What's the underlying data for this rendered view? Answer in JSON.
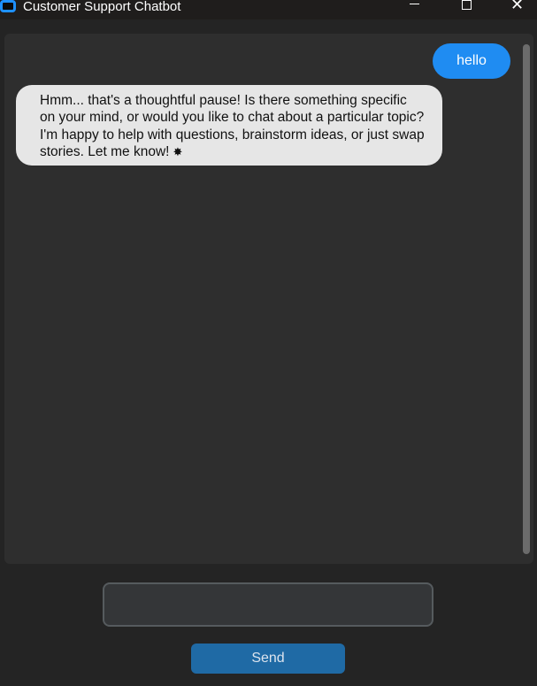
{
  "window": {
    "title": "Customer Support Chatbot",
    "minimize_icon": "minimize-icon",
    "maximize_icon": "maximize-icon",
    "close_icon": "close-icon",
    "close_glyph": "✕"
  },
  "chat": {
    "messages": [
      {
        "sender": "user",
        "text": "hello",
        "color": "#1f8cf2"
      },
      {
        "sender": "bot",
        "text": "Hmm... that's a thoughtful pause! Is there something specific on your mind, or would you like to chat about a particular topic? I'm happy to help with questions, brainstorm ideas, or just swap stories. Let me know!",
        "emoji": "✸",
        "emoji_icon": "sparkle-icon",
        "color": "#e6e6e6"
      }
    ]
  },
  "composer": {
    "input_value": "",
    "send_label": "Send",
    "send_color": "#1f6aa5"
  },
  "colors": {
    "background": "#242424",
    "panel": "#2e2e2e",
    "accent": "#1f8cf2"
  }
}
